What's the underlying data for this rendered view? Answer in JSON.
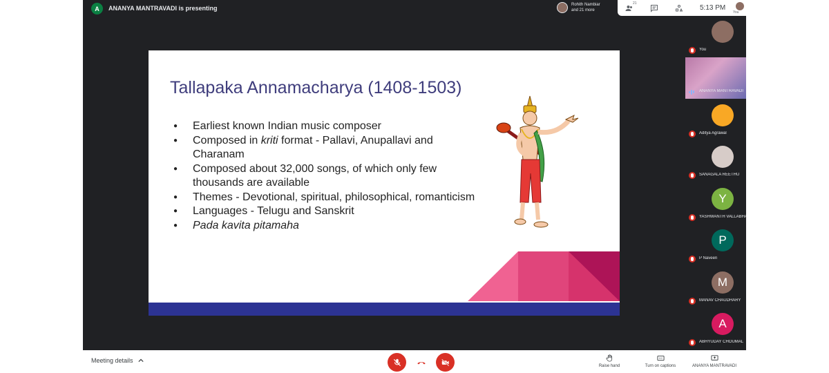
{
  "presenter": {
    "initial": "A",
    "banner": "ANANYA MANTRAVADI is presenting"
  },
  "viewers": {
    "line1": "Rohith Nambiar",
    "line2": "and 21 more"
  },
  "topbar": {
    "people_count": "21",
    "time": "5:13 PM",
    "self_label": "You"
  },
  "slide": {
    "title": "Tallapaka Annamacharya (1408-1503)",
    "bullets": {
      "b1": "Earliest known Indian music composer",
      "b2_pre": "Composed in ",
      "b2_em": "kriti",
      "b2_post": " format - Pallavi, Anupallavi and Charanam",
      "b3": "Composed about 32,000 songs, of which only few thousands are available",
      "b4": "Themes - Devotional, spiritual, philosophical, romanticism",
      "b5": "Languages - Telugu and Sanskrit",
      "b6": "Pada kavita pitamaha"
    },
    "colors": {
      "title": "#3f3d7c",
      "footer": "#2c3393",
      "triangle_light": "#f06292",
      "triangle_mid": "#e0457b",
      "triangle_dark": "#ad1457"
    }
  },
  "participants": [
    {
      "name": "You",
      "initial": "",
      "color": "#8d6e63"
    },
    {
      "name": "ANANYA MANTRAVADI",
      "initial": "",
      "color": ""
    },
    {
      "name": "Aditya Agrawal",
      "initial": "",
      "color": "#f9a825"
    },
    {
      "name": "SANAGALA REETHU",
      "initial": "",
      "color": "#d7ccc8"
    },
    {
      "name": "YASHWANTH VALLABHANENI",
      "initial": "Y",
      "color": "#7cb342"
    },
    {
      "name": "P Naveen",
      "initial": "P",
      "color": "#00695c"
    },
    {
      "name": "MANAV CHAUDHARY",
      "initial": "M",
      "color": "#8d6e63"
    },
    {
      "name": "ABHYUDAY CHOUMAL",
      "initial": "A",
      "color": "#d81b60"
    }
  ],
  "bottombar": {
    "meeting_details": "Meeting details",
    "raise_hand": "Raise hand",
    "captions": "Turn on captions",
    "presenting_label": "ANANYA MANTRAVADI"
  },
  "icons": {
    "mic": "mic-off-icon",
    "hangup": "call-end-icon",
    "camera": "videocam-off-icon",
    "people": "people-icon",
    "chat": "chat-icon",
    "activities": "activities-icon",
    "raise": "hand-icon",
    "cc": "closed-captions-icon",
    "present": "present-screen-icon"
  }
}
